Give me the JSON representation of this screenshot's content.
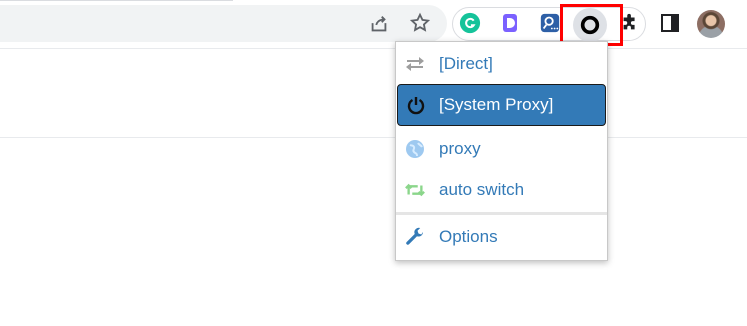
{
  "browser": {
    "icons": {
      "share": "share-icon",
      "bookmark": "star-icon",
      "grammarly": "grammarly-icon",
      "dproxy": "d-extension-icon",
      "zoom": "zoom-scheduler-icon",
      "switchyomega": "switchyomega-circle-icon",
      "extensions": "puzzle-icon",
      "side_panel": "side-panel-icon",
      "profile": "avatar"
    },
    "colors": {
      "highlight": "#ff0000",
      "grammarly": "#15c39a",
      "dproxy": "#7b61ff",
      "zoom": "#2d5fa6"
    }
  },
  "popup": {
    "items": [
      {
        "label": "[Direct]",
        "icon": "arrows-exchange-icon",
        "selected": false
      },
      {
        "label": "[System Proxy]",
        "icon": "power-icon",
        "selected": true
      },
      {
        "label": "proxy",
        "icon": "globe-icon",
        "selected": false
      },
      {
        "label": "auto switch",
        "icon": "retweet-icon",
        "selected": false
      },
      {
        "label": "Options",
        "icon": "wrench-icon",
        "selected": false
      }
    ],
    "colors": {
      "link": "#337ab7",
      "selected_bg": "#337ab7",
      "selected_text": "#ffffff"
    }
  }
}
